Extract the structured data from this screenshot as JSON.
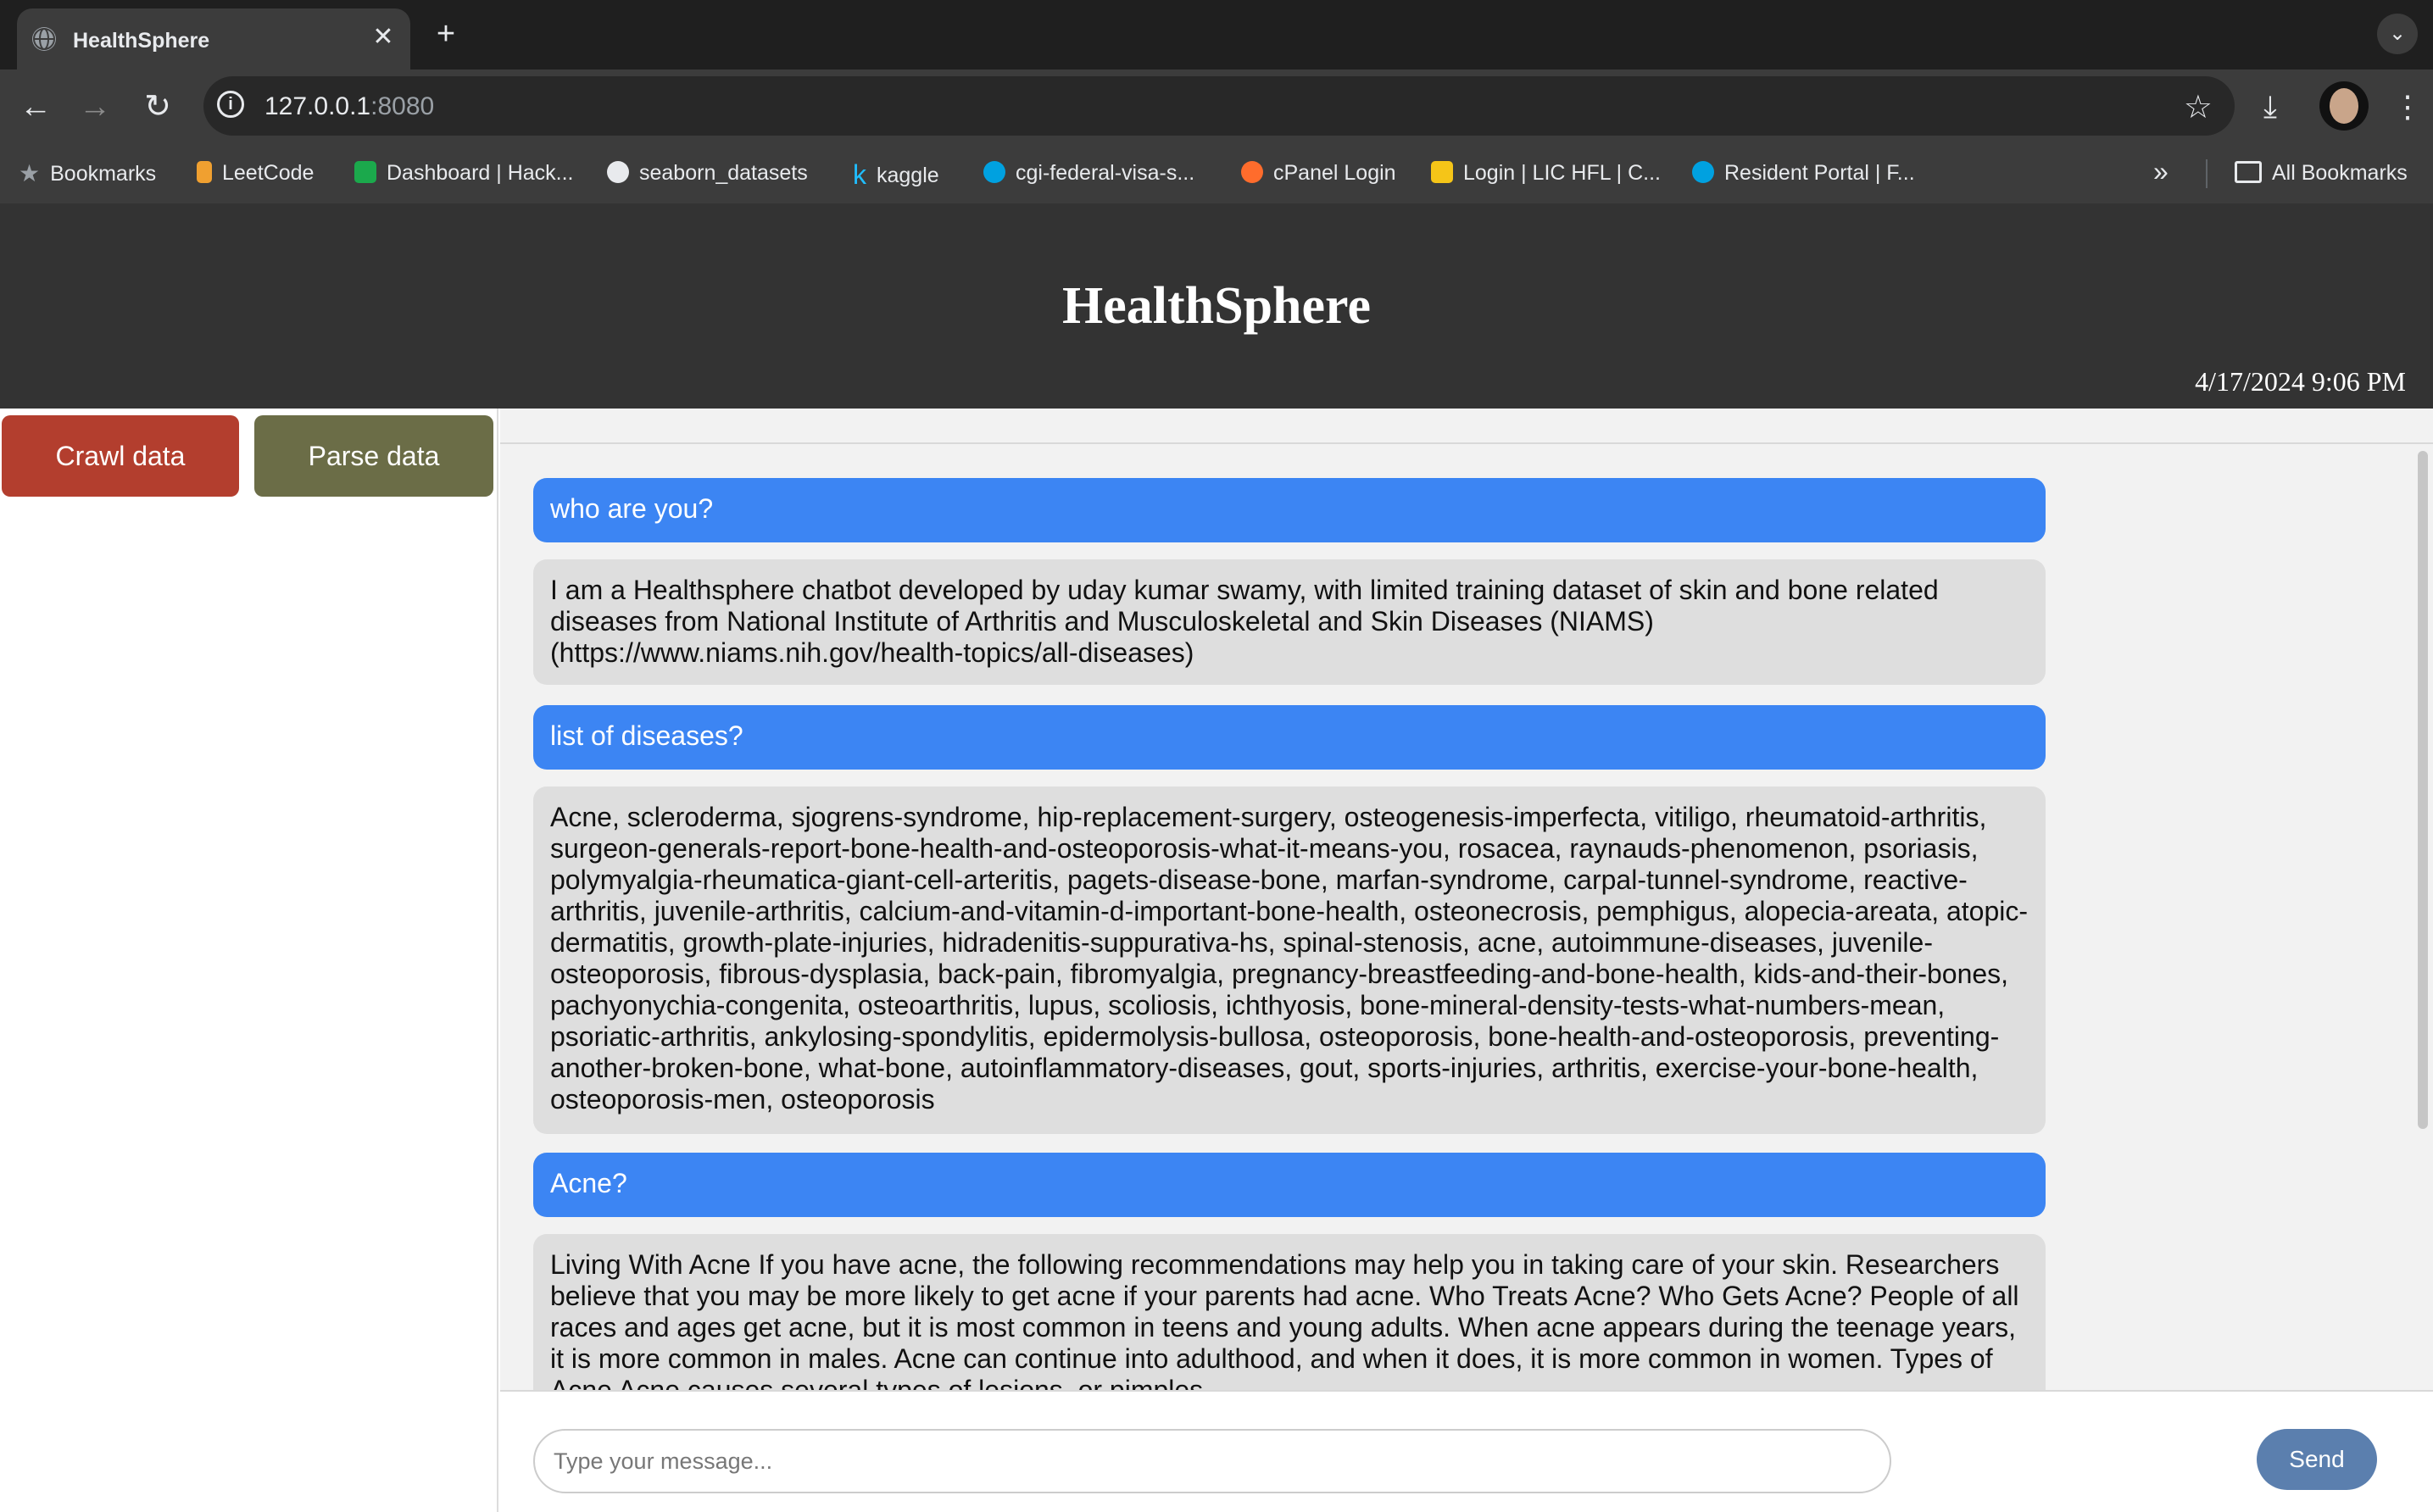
{
  "browser": {
    "tab_title": "HealthSphere",
    "tab_close": "✕",
    "new_tab": "+",
    "tab_search": "⌄",
    "url_host": "127.0.0.1",
    "url_port": ":8080",
    "back": "←",
    "forward": "→",
    "reload": "↻",
    "star": "☆",
    "download": "⤓",
    "menu": "⋮",
    "bookmarks": [
      {
        "label": "Bookmarks",
        "icon": "star-icon",
        "color": "#9aa0a6"
      },
      {
        "label": "LeetCode",
        "icon": "leetcode-icon",
        "color": "#f0a030"
      },
      {
        "label": "Dashboard | Hack...",
        "icon": "hackerrank-icon",
        "color": "#1ba94c"
      },
      {
        "label": "seaborn_datasets",
        "icon": "github-icon",
        "color": "#e8eaed"
      },
      {
        "label": "kaggle",
        "icon": "kaggle-icon",
        "color": "#20beff"
      },
      {
        "label": "cgi-federal-visa-s...",
        "icon": "salesforce-cloud-icon",
        "color": "#00a1e0"
      },
      {
        "label": "cPanel Login",
        "icon": "cpanel-icon",
        "color": "#ff6c2c"
      },
      {
        "label": "Login | LIC HFL | C...",
        "icon": "lic-icon",
        "color": "#f5c518"
      },
      {
        "label": "Resident Portal | F...",
        "icon": "salesforce-cloud-icon",
        "color": "#00a1e0"
      }
    ],
    "more_bookmarks": "»",
    "all_bookmarks": "All Bookmarks"
  },
  "app": {
    "title": "HealthSphere",
    "datetime": "4/17/2024 9:06 PM",
    "sidebar": {
      "crawl_label": "Crawl data",
      "parse_label": "Parse data"
    },
    "messages": [
      {
        "role": "user",
        "text": "who are you?"
      },
      {
        "role": "bot",
        "text": "I am a Healthsphere chatbot developed by uday kumar swamy, with limited training dataset of skin and bone related diseases from National Institute of Arthritis and Musculoskeletal and Skin Diseases (NIAMS) (https://www.niams.nih.gov/health-topics/all-diseases)"
      },
      {
        "role": "user",
        "text": "list of diseases?"
      },
      {
        "role": "bot",
        "text": "Acne, scleroderma, sjogrens-syndrome, hip-replacement-surgery, osteogenesis-imperfecta, vitiligo, rheumatoid-arthritis, surgeon-generals-report-bone-health-and-osteoporosis-what-it-means-you, rosacea, raynauds-phenomenon, psoriasis, polymyalgia-rheumatica-giant-cell-arteritis, pagets-disease-bone, marfan-syndrome, carpal-tunnel-syndrome, reactive-arthritis, juvenile-arthritis, calcium-and-vitamin-d-important-bone-health, osteonecrosis, pemphigus, alopecia-areata, atopic-dermatitis, growth-plate-injuries, hidradenitis-suppurativa-hs, spinal-stenosis, acne, autoimmune-diseases, juvenile-osteoporosis, fibrous-dysplasia, back-pain, fibromyalgia, pregnancy-breastfeeding-and-bone-health, kids-and-their-bones, pachyonychia-congenita, osteoarthritis, lupus, scoliosis, ichthyosis, bone-mineral-density-tests-what-numbers-mean, psoriatic-arthritis, ankylosing-spondylitis, epidermolysis-bullosa, osteoporosis, bone-health-and-osteoporosis, preventing-another-broken-bone, what-bone, autoinflammatory-diseases, gout, sports-injuries, arthritis, exercise-your-bone-health, osteoporosis-men, osteoporosis"
      },
      {
        "role": "user",
        "text": "Acne?"
      },
      {
        "role": "bot",
        "text": "Living With Acne If you have acne, the following recommendations may help you in taking care of your skin. Researchers believe that you may be more likely to get acne if your parents had acne. Who Treats Acne? Who Gets Acne? People of all races and ages get acne, but it is most common in teens and young adults. When acne appears during the teenage years, it is more common in males. Acne can continue into adulthood, and when it does, it is more common in women. Types of Acne Acne causes several types of lesions, or pimples."
      }
    ],
    "input_placeholder": "Type your message...",
    "input_value": "",
    "send_label": "Send"
  }
}
